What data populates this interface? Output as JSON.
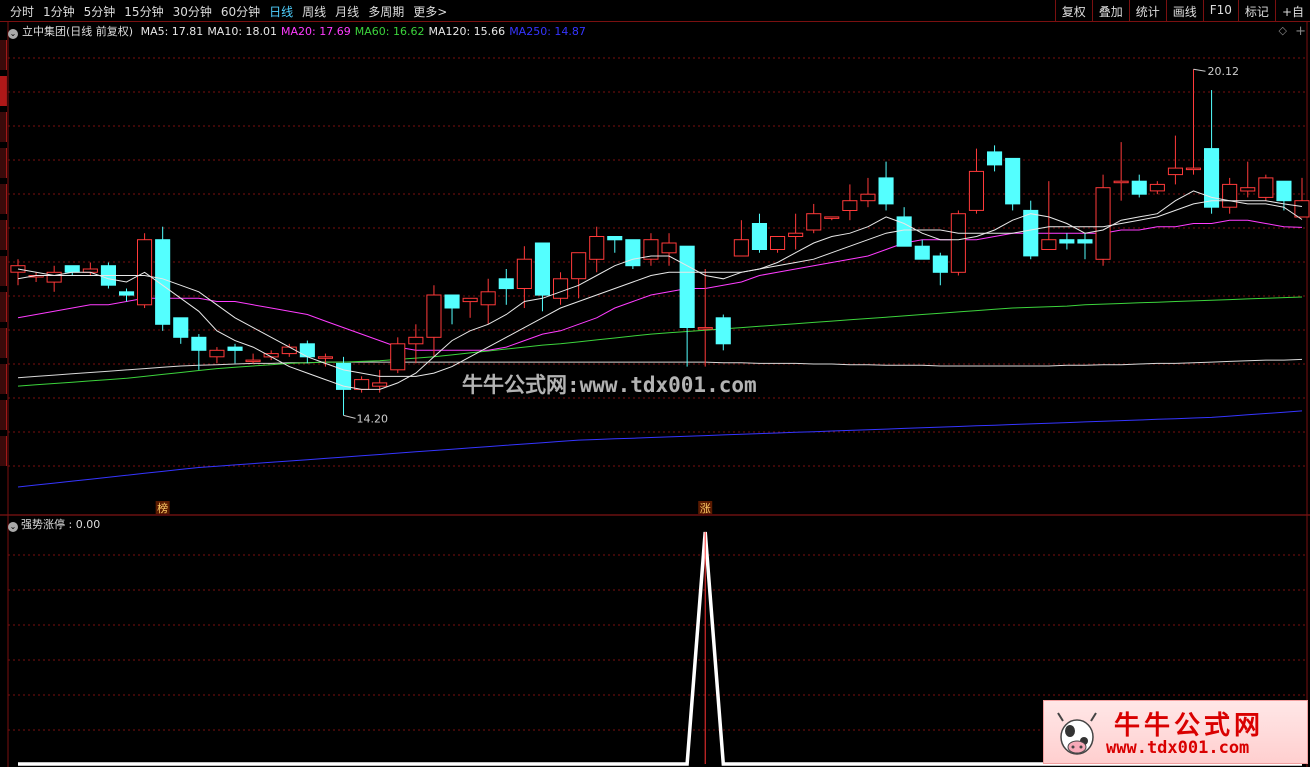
{
  "toolbar": {
    "periods": [
      "分时",
      "1分钟",
      "5分钟",
      "15分钟",
      "30分钟",
      "60分钟",
      "日线",
      "周线",
      "月线",
      "多周期",
      "更多>"
    ],
    "active_period": 6,
    "tools": [
      "复权",
      "叠加",
      "统计",
      "画线",
      "F10",
      "标记",
      "+自"
    ]
  },
  "side_tabs": [
    "",
    "",
    "",
    "",
    "",
    "",
    "",
    "",
    "",
    "",
    "",
    ""
  ],
  "colors": {
    "up": "#ff3a3a",
    "down": "#54ffff",
    "ma5": "#e8e8e8",
    "ma10": "#e8e8e8",
    "ma20": "#ff3cff",
    "ma60": "#3cd33c",
    "ma120": "#d8d8d8",
    "ma250": "#3535ff",
    "indicator": "#ffffff",
    "grid": "#7a1010",
    "axis_text": "#cccccc"
  },
  "watermark": "牛牛公式网:www.tdx001.com",
  "logo": {
    "line1": "牛牛公式网",
    "line2": "www.tdx001.com"
  },
  "chart_data": [
    {
      "type": "candlestick",
      "title": "立中集团(日线 前复权)",
      "legend_icon": "chevron-down-icon",
      "ma_legend": [
        {
          "label": "MA5: 17.81",
          "color": "#e8e8e8"
        },
        {
          "label": "MA10: 18.01",
          "color": "#e8e8e8"
        },
        {
          "label": "MA20: 17.69",
          "color": "#ff3cff"
        },
        {
          "label": "MA60: 16.62",
          "color": "#3cd33c"
        },
        {
          "label": "MA120: 15.66",
          "color": "#e8e8e8"
        },
        {
          "label": "MA250: 14.87",
          "color": "#3535ff"
        }
      ],
      "ylim": [
        13.5,
        20.6
      ],
      "high_label": "20.12",
      "low_label": "14.20",
      "markers": [
        {
          "index": 8,
          "text": "榜"
        },
        {
          "index": 38,
          "text": "涨"
        }
      ],
      "candles": [
        [
          17.0,
          17.1,
          16.8,
          17.2
        ],
        [
          16.95,
          16.95,
          16.85,
          17.0
        ],
        [
          16.85,
          17.0,
          16.7,
          17.1
        ],
        [
          17.1,
          17.0,
          16.95,
          17.1
        ],
        [
          17.0,
          17.05,
          16.95,
          17.15
        ],
        [
          17.1,
          16.8,
          16.75,
          17.15
        ],
        [
          16.7,
          16.65,
          16.55,
          16.75
        ],
        [
          16.5,
          17.5,
          16.45,
          17.6
        ],
        [
          17.5,
          16.2,
          16.1,
          17.7
        ],
        [
          16.3,
          16.0,
          15.9,
          16.3
        ],
        [
          16.0,
          15.8,
          15.5,
          16.05
        ],
        [
          15.7,
          15.8,
          15.6,
          15.85
        ],
        [
          15.85,
          15.8,
          15.6,
          15.9
        ],
        [
          15.65,
          15.65,
          15.6,
          15.75
        ],
        [
          15.7,
          15.75,
          15.65,
          15.8
        ],
        [
          15.75,
          15.85,
          15.7,
          15.9
        ],
        [
          15.9,
          15.7,
          15.6,
          15.95
        ],
        [
          15.7,
          15.7,
          15.55,
          15.75
        ],
        [
          15.6,
          15.2,
          14.8,
          15.7
        ],
        [
          15.2,
          15.35,
          15.15,
          15.4
        ],
        [
          15.25,
          15.3,
          15.15,
          15.5
        ],
        [
          15.5,
          15.9,
          15.45,
          16.0
        ],
        [
          15.9,
          16.0,
          15.6,
          16.2
        ],
        [
          16.0,
          16.65,
          15.7,
          16.8
        ],
        [
          16.65,
          16.45,
          16.2,
          16.65
        ],
        [
          16.55,
          16.6,
          16.3,
          16.6
        ],
        [
          16.5,
          16.7,
          16.2,
          16.9
        ],
        [
          16.9,
          16.75,
          16.5,
          17.05
        ],
        [
          16.75,
          17.2,
          16.45,
          17.4
        ],
        [
          17.45,
          16.65,
          16.4,
          17.45
        ],
        [
          16.6,
          16.9,
          16.5,
          17.0
        ],
        [
          16.9,
          17.3,
          16.6,
          17.3
        ],
        [
          17.2,
          17.55,
          17.0,
          17.7
        ],
        [
          17.55,
          17.5,
          17.3,
          17.55
        ],
        [
          17.5,
          17.1,
          17.05,
          17.5
        ],
        [
          17.2,
          17.5,
          17.1,
          17.6
        ],
        [
          17.3,
          17.45,
          17.1,
          17.6
        ],
        [
          17.4,
          16.15,
          15.55,
          17.4
        ],
        [
          16.15,
          16.15,
          15.55,
          17.05
        ],
        [
          16.3,
          15.9,
          15.8,
          16.35
        ],
        [
          17.25,
          17.5,
          17.3,
          17.8
        ],
        [
          17.75,
          17.35,
          17.3,
          17.9
        ],
        [
          17.35,
          17.55,
          17.3,
          17.55
        ],
        [
          17.55,
          17.6,
          17.35,
          17.9
        ],
        [
          17.65,
          17.9,
          17.6,
          18.05
        ],
        [
          17.85,
          17.85,
          17.8,
          17.85
        ],
        [
          17.95,
          18.1,
          17.8,
          18.35
        ],
        [
          18.1,
          18.2,
          18.0,
          18.45
        ],
        [
          18.45,
          18.05,
          17.95,
          18.7
        ],
        [
          17.85,
          17.4,
          17.4,
          18.0
        ],
        [
          17.4,
          17.2,
          17.2,
          17.5
        ],
        [
          17.25,
          17.0,
          16.8,
          17.3
        ],
        [
          17.0,
          17.9,
          16.95,
          17.95
        ],
        [
          17.95,
          18.55,
          17.9,
          18.9
        ],
        [
          18.85,
          18.65,
          18.55,
          18.95
        ],
        [
          18.75,
          18.05,
          17.95,
          18.75
        ],
        [
          17.95,
          17.25,
          17.2,
          18.1
        ],
        [
          17.35,
          17.5,
          17.4,
          18.4
        ],
        [
          17.5,
          17.45,
          17.35,
          17.6
        ],
        [
          17.5,
          17.45,
          17.2,
          17.6
        ],
        [
          17.2,
          18.3,
          17.1,
          18.5
        ],
        [
          18.4,
          18.4,
          18.1,
          19.0
        ],
        [
          18.4,
          18.2,
          18.15,
          18.5
        ],
        [
          18.25,
          18.35,
          18.2,
          18.4
        ],
        [
          18.5,
          18.6,
          18.35,
          19.1
        ],
        [
          18.6,
          18.6,
          18.5,
          20.12
        ],
        [
          18.9,
          18.0,
          17.9,
          19.8
        ],
        [
          18.0,
          18.35,
          17.9,
          18.45
        ],
        [
          18.25,
          18.3,
          18.15,
          18.7
        ],
        [
          18.15,
          18.45,
          18.1,
          18.5
        ],
        [
          18.4,
          18.1,
          17.95,
          18.4
        ],
        [
          17.85,
          18.1,
          18.0,
          18.45
        ]
      ],
      "ma5": [
        17.05,
        17.0,
        16.95,
        17.0,
        17.0,
        16.9,
        16.85,
        17.0,
        16.8,
        16.6,
        16.4,
        16.1,
        15.95,
        15.85,
        15.7,
        15.55,
        15.45,
        15.35,
        15.25,
        15.2,
        15.2,
        15.3,
        15.45,
        15.7,
        15.95,
        16.1,
        16.2,
        16.35,
        16.55,
        16.6,
        16.7,
        16.8,
        16.95,
        17.1,
        17.2,
        17.25,
        17.25,
        17.1,
        16.95,
        16.9,
        17.0,
        17.05,
        17.15,
        17.3,
        17.45,
        17.55,
        17.6,
        17.7,
        17.85,
        17.75,
        17.6,
        17.5,
        17.5,
        17.55,
        17.65,
        17.8,
        17.9,
        17.85,
        17.75,
        17.6,
        17.65,
        17.8,
        17.85,
        17.9,
        18.1,
        18.25,
        18.15,
        18.1,
        18.05,
        18.05,
        18.0,
        17.81
      ],
      "ma10": [
        16.9,
        16.95,
        16.95,
        16.95,
        16.95,
        16.95,
        16.95,
        16.95,
        16.9,
        16.8,
        16.7,
        16.5,
        16.3,
        16.15,
        16.0,
        15.85,
        15.7,
        15.6,
        15.5,
        15.45,
        15.4,
        15.4,
        15.4,
        15.45,
        15.55,
        15.7,
        15.85,
        16.0,
        16.15,
        16.3,
        16.45,
        16.55,
        16.65,
        16.75,
        16.85,
        16.95,
        17.0,
        17.0,
        17.0,
        17.0,
        17.0,
        17.05,
        17.1,
        17.15,
        17.2,
        17.3,
        17.4,
        17.5,
        17.6,
        17.65,
        17.65,
        17.65,
        17.6,
        17.6,
        17.6,
        17.6,
        17.65,
        17.7,
        17.7,
        17.7,
        17.7,
        17.75,
        17.8,
        17.85,
        17.95,
        18.05,
        18.1,
        18.1,
        18.1,
        18.1,
        18.05,
        18.01
      ],
      "ma20": [
        16.3,
        16.35,
        16.4,
        16.45,
        16.5,
        16.5,
        16.55,
        16.6,
        16.6,
        16.6,
        16.6,
        16.55,
        16.55,
        16.5,
        16.45,
        16.4,
        16.35,
        16.25,
        16.15,
        16.05,
        15.95,
        15.85,
        15.8,
        15.8,
        15.8,
        15.8,
        15.8,
        15.85,
        15.95,
        16.05,
        16.1,
        16.2,
        16.3,
        16.45,
        16.55,
        16.65,
        16.7,
        16.75,
        16.75,
        16.8,
        16.85,
        16.95,
        17.0,
        17.05,
        17.1,
        17.15,
        17.2,
        17.25,
        17.35,
        17.45,
        17.5,
        17.5,
        17.5,
        17.5,
        17.55,
        17.6,
        17.6,
        17.6,
        17.6,
        17.6,
        17.6,
        17.65,
        17.65,
        17.7,
        17.7,
        17.75,
        17.75,
        17.8,
        17.8,
        17.75,
        17.7,
        17.69
      ],
      "ma60": [
        15.25,
        15.27,
        15.29,
        15.31,
        15.33,
        15.35,
        15.37,
        15.4,
        15.43,
        15.46,
        15.49,
        15.52,
        15.54,
        15.56,
        15.58,
        15.6,
        15.61,
        15.62,
        15.62,
        15.63,
        15.64,
        15.66,
        15.68,
        15.7,
        15.73,
        15.76,
        15.79,
        15.82,
        15.85,
        15.88,
        15.9,
        15.93,
        15.96,
        15.99,
        16.02,
        16.05,
        16.07,
        16.09,
        16.11,
        16.13,
        16.15,
        16.17,
        16.19,
        16.21,
        16.23,
        16.25,
        16.27,
        16.29,
        16.31,
        16.33,
        16.35,
        16.37,
        16.39,
        16.41,
        16.43,
        16.45,
        16.46,
        16.47,
        16.48,
        16.5,
        16.51,
        16.52,
        16.53,
        16.54,
        16.55,
        16.56,
        16.57,
        16.58,
        16.59,
        16.6,
        16.61,
        16.62
      ],
      "ma120": [
        15.38,
        15.4,
        15.42,
        15.44,
        15.46,
        15.48,
        15.5,
        15.52,
        15.54,
        15.56,
        15.57,
        15.58,
        15.59,
        15.6,
        15.6,
        15.61,
        15.61,
        15.62,
        15.62,
        15.62,
        15.62,
        15.62,
        15.62,
        15.62,
        15.62,
        15.62,
        15.62,
        15.62,
        15.62,
        15.62,
        15.62,
        15.62,
        15.62,
        15.62,
        15.62,
        15.62,
        15.62,
        15.62,
        15.62,
        15.61,
        15.61,
        15.6,
        15.6,
        15.6,
        15.59,
        15.59,
        15.58,
        15.58,
        15.57,
        15.57,
        15.57,
        15.56,
        15.56,
        15.56,
        15.56,
        15.56,
        15.56,
        15.56,
        15.57,
        15.57,
        15.58,
        15.58,
        15.59,
        15.6,
        15.6,
        15.61,
        15.62,
        15.63,
        15.64,
        15.65,
        15.65,
        15.66
      ],
      "ma250": [
        13.7,
        13.73,
        13.76,
        13.79,
        13.82,
        13.85,
        13.88,
        13.91,
        13.94,
        13.97,
        14.0,
        14.02,
        14.04,
        14.06,
        14.08,
        14.1,
        14.12,
        14.14,
        14.16,
        14.18,
        14.2,
        14.22,
        14.24,
        14.26,
        14.28,
        14.3,
        14.32,
        14.34,
        14.36,
        14.38,
        14.4,
        14.42,
        14.43,
        14.44,
        14.45,
        14.46,
        14.47,
        14.48,
        14.49,
        14.5,
        14.51,
        14.52,
        14.53,
        14.54,
        14.55,
        14.56,
        14.57,
        14.58,
        14.59,
        14.6,
        14.61,
        14.62,
        14.63,
        14.64,
        14.65,
        14.66,
        14.67,
        14.68,
        14.69,
        14.7,
        14.71,
        14.72,
        14.73,
        14.74,
        14.75,
        14.76,
        14.77,
        14.79,
        14.81,
        14.83,
        14.85,
        14.87
      ]
    },
    {
      "type": "line",
      "title": "强势涨停",
      "value_label": ": 0.00",
      "legend_icon": "chevron-down-icon",
      "ylim": [
        0,
        1
      ],
      "values": [
        0,
        0,
        0,
        0,
        0,
        0,
        0,
        0,
        0,
        0,
        0,
        0,
        0,
        0,
        0,
        0,
        0,
        0,
        0,
        0,
        0,
        0,
        0,
        0,
        0,
        0,
        0,
        0,
        0,
        0,
        0,
        0,
        0,
        0,
        0,
        0,
        0,
        0,
        1,
        0,
        0,
        0,
        0,
        0,
        0,
        0,
        0,
        0,
        0,
        0,
        0,
        0,
        0,
        0,
        0,
        0,
        0,
        0,
        0,
        0,
        0,
        0,
        0,
        0,
        0,
        0,
        0,
        0,
        0,
        0,
        0,
        0
      ]
    }
  ]
}
